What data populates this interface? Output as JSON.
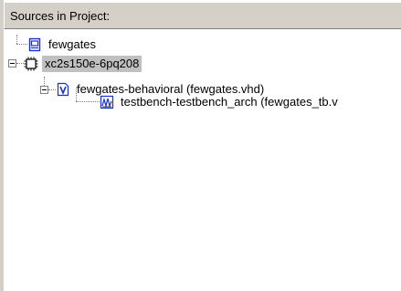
{
  "panel": {
    "header": "Sources in Project:"
  },
  "tree": {
    "items": [
      {
        "label": "fewgates",
        "icon": "project-module-icon",
        "depth": 0
      },
      {
        "label": "xc2s150e-6pq208",
        "icon": "chip-device-icon",
        "depth": 0,
        "selected": true,
        "expanded": true
      },
      {
        "label": "fewgates-behavioral (fewgates.vhd)",
        "icon": "vhdl-source-icon",
        "depth": 1,
        "expanded": true
      },
      {
        "label": "testbench-testbench_arch (fewgates_tb.v",
        "icon": "testbench-icon",
        "depth": 2
      }
    ]
  },
  "colors": {
    "header_bg": "#d4d0c8",
    "selected_bg": "#c0c0c0",
    "icon_blue": "#1a2fcf"
  }
}
